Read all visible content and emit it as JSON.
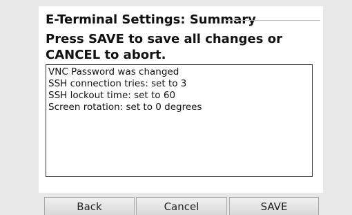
{
  "settings": {
    "title": "E-Terminal Settings: Summary",
    "instruction": "Press SAVE to save all changes or CANCEL to abort.",
    "summary_lines": [
      "VNC Password was changed",
      "SSH connection tries: set to 3",
      "SSH lockout time: set to 60",
      "Screen rotation: set to 0 degrees"
    ]
  },
  "buttons": {
    "back_label": "Back",
    "cancel_label": "Cancel",
    "save_label": "SAVE"
  }
}
